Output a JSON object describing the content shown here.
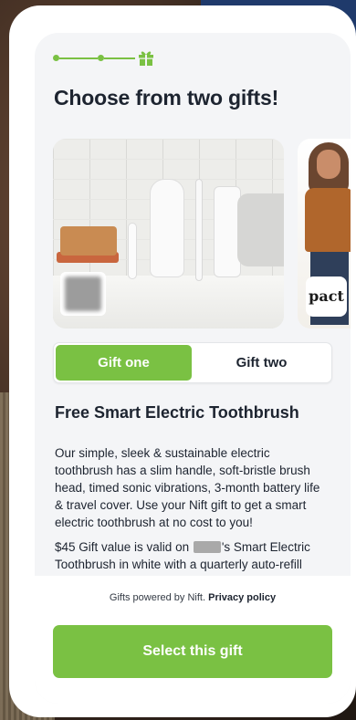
{
  "header": {
    "title": "Choose from two gifts!",
    "stepper": {
      "steps": 3,
      "current_icon": "gift-icon",
      "color": "#7ac143"
    }
  },
  "carousel": {
    "slides": [
      {
        "name": "Smart Electric Toothbrush product photo",
        "logo": ""
      },
      {
        "name": "Pact clothing photo",
        "brand_label": "pact"
      }
    ]
  },
  "tabs": [
    {
      "label": "Gift one",
      "active": true
    },
    {
      "label": "Gift two",
      "active": false
    }
  ],
  "gift": {
    "title": "Free Smart Electric Toothbrush",
    "description": " Our simple, sleek & sustainable electric toothbrush has a slim handle, soft-bristle brush head, timed sonic vibrations, 3-month battery life & travel cover. Use your Nift gift to get a smart electric toothbrush at no cost to you!",
    "value_prefix": "$45 Gift value is valid on ",
    "value_suffix": "'s Smart Electric Toothbrush in white with a quarterly auto-refill"
  },
  "footer": {
    "powered_text": "Gifts powered by Nift.",
    "privacy_label": "Privacy policy",
    "cta_label": "Select this gift"
  },
  "colors": {
    "accent": "#7ac143",
    "text": "#1d2430",
    "card_bg": "#f4f5f7"
  }
}
